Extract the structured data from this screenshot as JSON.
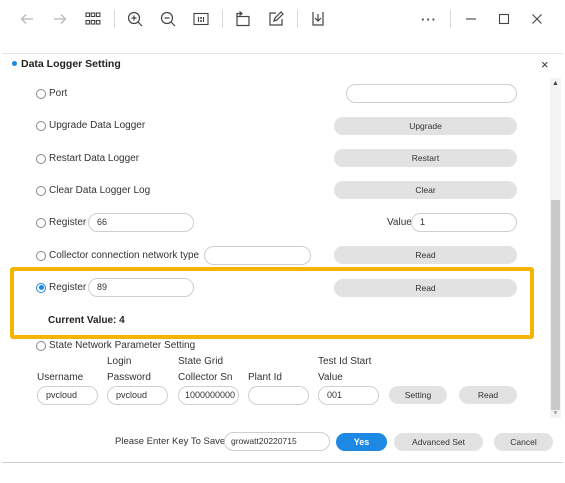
{
  "toolbar": {
    "icons": [
      "back-arrow-icon",
      "forward-arrow-icon",
      "grid-icon",
      "zoom-in-icon",
      "zoom-out-icon",
      "actual-size-icon",
      "rotate-icon",
      "edit-icon",
      "save-icon",
      "more-icon",
      "minimize-icon",
      "maximize-icon",
      "close-icon"
    ],
    "more_label": "···"
  },
  "dialog": {
    "title": "Data Logger Setting",
    "close_label": "×"
  },
  "rows": {
    "port": {
      "label": "Port",
      "value": ""
    },
    "upgrade": {
      "label": "Upgrade Data Logger",
      "button": "Upgrade"
    },
    "restart": {
      "label": "Restart Data Logger",
      "button": "Restart"
    },
    "clear": {
      "label": "Clear Data Logger Log",
      "button": "Clear"
    },
    "register1": {
      "label": "Register",
      "value": "66",
      "value_label": "Value",
      "value_value": "1"
    },
    "collector": {
      "label": "Collector connection network type",
      "value": "",
      "button": "Read"
    },
    "register2": {
      "label": "Register",
      "value": "89",
      "button": "Read",
      "selected": true
    },
    "current_value": "Current Value:  4"
  },
  "state_grid": {
    "label": "State Network Parameter Setting",
    "headers": {
      "username": "Username",
      "login_password_line1": "Login",
      "login_password_line2": "Password",
      "collector_sn_line1": "State Grid",
      "collector_sn_line2": "Collector Sn",
      "plant_id": "Plant Id",
      "test_id_line1": "Test Id Start",
      "test_id_line2": "Value"
    },
    "values": {
      "username": "pvcloud",
      "password": "pvcloud",
      "collector_sn": "1000000000",
      "plant_id": "",
      "test_id": "001"
    },
    "setting_button": "Setting",
    "read_button": "Read"
  },
  "footer": {
    "prompt": "Please Enter Key To Save",
    "key_value": "growatt20220715",
    "yes_button": "Yes",
    "advanced_button": "Advanced Set",
    "cancel_button": "Cancel"
  },
  "colors": {
    "accent": "#1e88e5",
    "highlight": "#f5b400",
    "button_gray": "#e2e2e2"
  }
}
